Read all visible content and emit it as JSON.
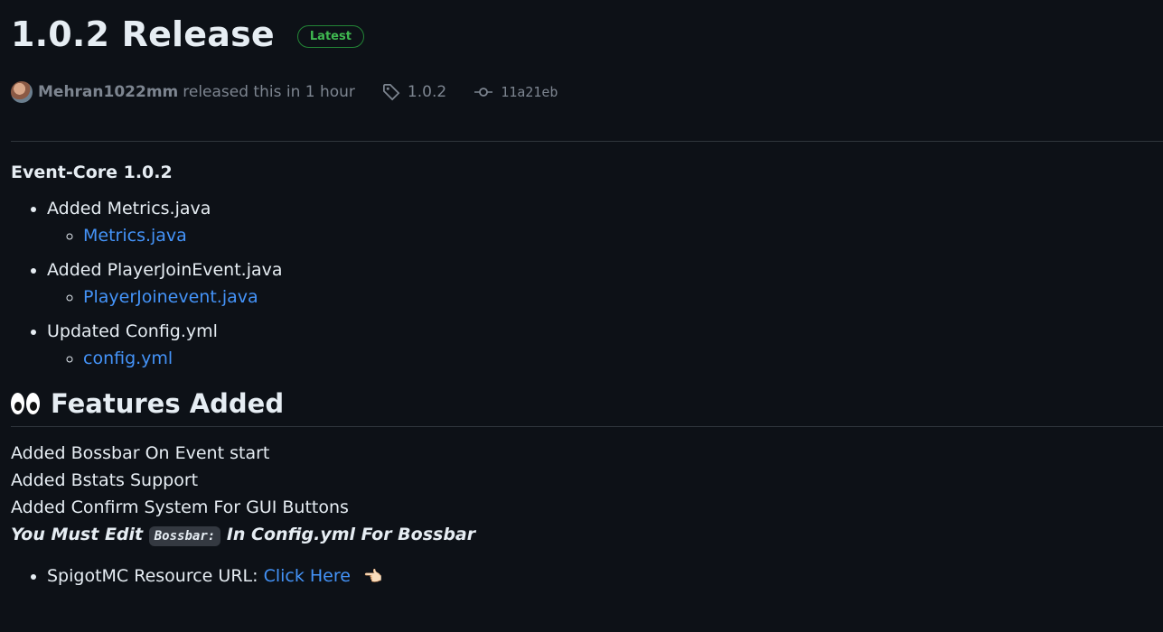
{
  "release": {
    "title": "1.0.2 Release",
    "badge": "Latest",
    "author": "Mehran1022mm",
    "released_text": "released this in 1 hour",
    "tag": "1.0.2",
    "commit": "11a21eb"
  },
  "notes": {
    "subtitle": "Event-Core 1.0.2",
    "items": [
      {
        "label": "Added Metrics.java",
        "link": "Metrics.java"
      },
      {
        "label": "Added PlayerJoinEvent.java",
        "link": "PlayerJoinevent.java"
      },
      {
        "label": "Updated Config.yml",
        "link": "config.yml"
      }
    ],
    "features_heading": "Features Added",
    "features": [
      "Added Bossbar On Event start",
      "Added Bstats Support",
      "Added Confirm System For GUI Buttons"
    ],
    "note_prefix": "You Must Edit",
    "note_code": "Bossbar:",
    "note_suffix": "In Config.yml For Bossbar",
    "resource_label": "SpigotMC Resource URL:",
    "resource_link": "Click Here",
    "resource_emoji": "👈🏻"
  },
  "colors": {
    "background": "#0d1117",
    "link": "#4493f8",
    "badge": "#3fb950"
  },
  "icons": [
    "tag-icon",
    "commit-icon",
    "eyes-emoji-icon",
    "pointing-hand-icon"
  ]
}
